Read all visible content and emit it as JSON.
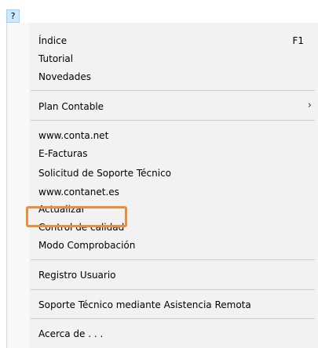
{
  "menubar": {
    "help_label": "?"
  },
  "menu": {
    "group1": [
      {
        "label": "Índice",
        "shortcut": "F1"
      },
      {
        "label": "Tutorial"
      },
      {
        "label": "Novedades"
      }
    ],
    "plan_contable": {
      "label": "Plan Contable",
      "arrow": "›"
    },
    "group3": [
      {
        "label": "www.conta.net"
      },
      {
        "label": "E-Facturas"
      },
      {
        "label": "Solicitud de Soporte Técnico"
      },
      {
        "label": "www.contanet.es"
      },
      {
        "label": "Actualizar"
      },
      {
        "label": "Control de calidad"
      },
      {
        "label": "Modo Comprobación"
      }
    ],
    "registro": {
      "label": "Registro Usuario"
    },
    "soporte_remoto": {
      "label": "Soporte Técnico mediante Asistencia Remota"
    },
    "acerca": {
      "label": "Acerca de . . ."
    }
  },
  "highlight": {
    "target": "Actualizar",
    "color": "#f08c35"
  }
}
